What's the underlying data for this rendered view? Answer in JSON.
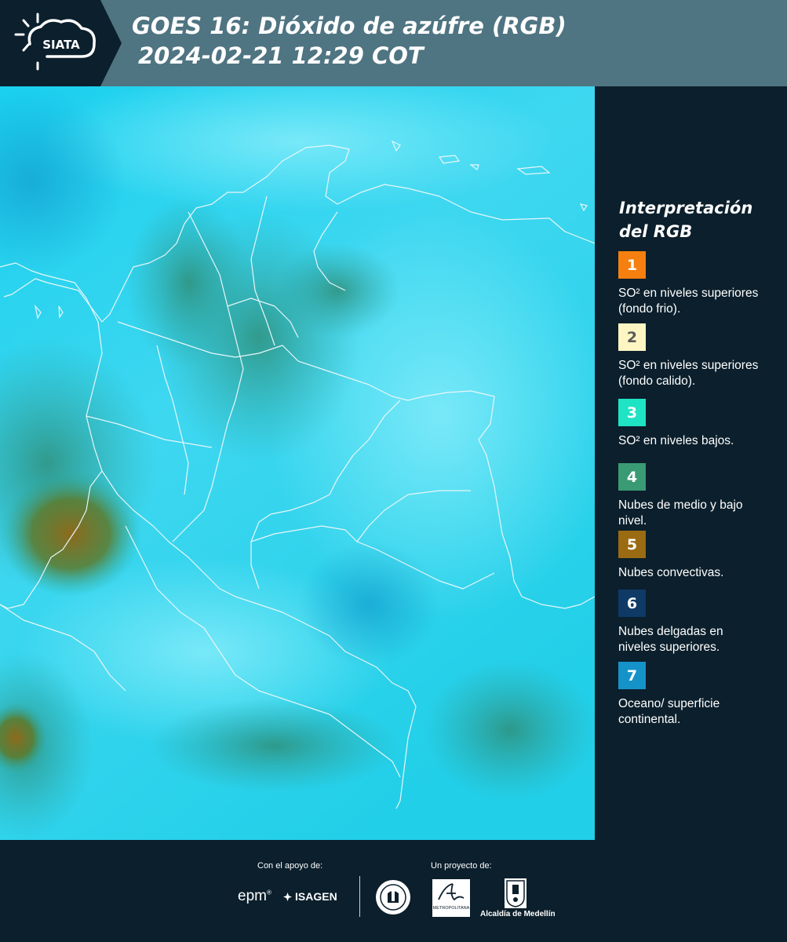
{
  "header": {
    "logo_text": "SIATA",
    "title_line1": "GOES 16: Dióxido de azúfre (RGB)",
    "title_line2": "2024-02-21 12:29 COT"
  },
  "legend": {
    "title_line1": "Interpretación",
    "title_line2": "del RGB",
    "items": [
      {
        "num": "1",
        "color": "#f5800f",
        "text_color": "#ffffff",
        "label": "SO² en niveles superiores (fondo frio)."
      },
      {
        "num": "2",
        "color": "#fdf6c2",
        "text_color": "#5a5a5a",
        "label": "SO² en niveles superiores (fondo calido)."
      },
      {
        "num": "3",
        "color": "#1ee4c4",
        "text_color": "#ffffff",
        "label": "SO² en niveles bajos."
      },
      {
        "num": "4",
        "color": "#3a9a74",
        "text_color": "#ffffff",
        "label": "Nubes de medio y bajo nivel."
      },
      {
        "num": "5",
        "color": "#9a6b12",
        "text_color": "#ffffff",
        "label": "Nubes convectivas."
      },
      {
        "num": "6",
        "color": "#0f3a66",
        "text_color": "#ffffff",
        "label": "Nubes delgadas en niveles superiores."
      },
      {
        "num": "7",
        "color": "#1593c8",
        "text_color": "#ffffff",
        "label": "Oceano/ superficie continental."
      }
    ]
  },
  "footer": {
    "support_label": "Con el apoyo de:",
    "project_label": "Un proyecto de:",
    "sponsor_epm": "epm",
    "sponsor_isagen": "ISAGEN",
    "sponsor_area_sub": "METROPOLITANA",
    "sponsor_alcaldia": "Alcaldía de Medellín"
  }
}
